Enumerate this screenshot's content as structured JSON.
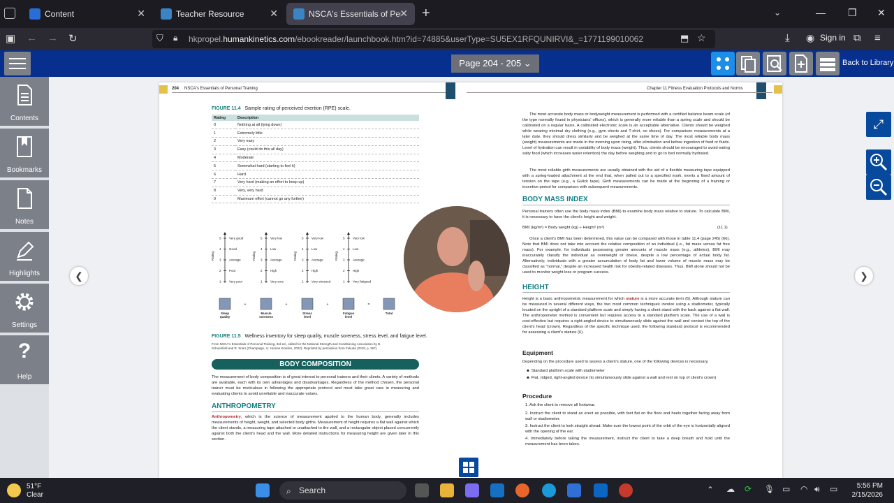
{
  "browser": {
    "tabs": [
      {
        "title": "Content",
        "favicon_color": "#2a6dd6"
      },
      {
        "title": "Teacher Resource",
        "favicon_color": "#3b84c4"
      },
      {
        "title": "NSCA's Essentials of Personal Tr",
        "favicon_color": "#3b84c4"
      }
    ],
    "url_prefix": "hkpropel.",
    "url_domain": "humankinetics.com",
    "url_path": "/ebookreader/launchbook.htm?id=74885&userType=SU5EX1RFQUNIRVI&_=1771199010062",
    "sign_in": "Sign in"
  },
  "reader": {
    "page_selector": "Page 204 - 205",
    "back_to_library": "Back to Library",
    "sidebar": [
      {
        "label": "Contents",
        "icon": "document-icon"
      },
      {
        "label": "Bookmarks",
        "icon": "bookmark-icon"
      },
      {
        "label": "Notes",
        "icon": "note-icon"
      },
      {
        "label": "Highlights",
        "icon": "pencil-icon"
      },
      {
        "label": "Settings",
        "icon": "gear-icon"
      },
      {
        "label": "Help",
        "icon": "question-icon"
      }
    ]
  },
  "book": {
    "left_page_number": "204",
    "left_running_head": "NSCA's Essentials of Personal Training",
    "right_running_head": "Chapter 11   Fitness Evaluation Protocols and Norms",
    "fig114_label": "FIGURE 11.4",
    "fig114_title": "Sample rating of perceived exertion (RPE) scale.",
    "rpe_headers": [
      "Rating",
      "Description"
    ],
    "rpe_rows": [
      [
        "0",
        "Nothing at all (lying down)"
      ],
      [
        "1",
        "Extremely little"
      ],
      [
        "2",
        "Very easy"
      ],
      [
        "3",
        "Easy (could do this all day)"
      ],
      [
        "4",
        "Moderate"
      ],
      [
        "5",
        "Somewhat hard (starting to feel it)"
      ],
      [
        "6",
        "Hard"
      ],
      [
        "7",
        "Very hard (making an effort to keep up)"
      ],
      [
        "8",
        "Very, very hard"
      ],
      [
        "9",
        "Maximum effort (cannot go any further)"
      ]
    ],
    "wellness_chart": {
      "axis_label": "Rating",
      "levels": [
        "5",
        "4",
        "3",
        "2",
        "1"
      ],
      "scales": [
        {
          "labels": [
            "Very good",
            "Good",
            "Average",
            "Poor",
            "Very poor"
          ],
          "caption": [
            "Sleep",
            "quality"
          ]
        },
        {
          "labels": [
            "Very low",
            "Low",
            "Average",
            "High",
            "Very sore"
          ],
          "caption": [
            "Muscle",
            "soreness"
          ]
        },
        {
          "labels": [
            "Very low",
            "Low",
            "Average",
            "High",
            "Very stressed"
          ],
          "caption": [
            "Stress",
            "level"
          ]
        },
        {
          "labels": [
            "Very low",
            "Low",
            "Average",
            "High",
            "Very fatigued"
          ],
          "caption": [
            "Fatigue",
            "level"
          ]
        }
      ],
      "operators": [
        "+",
        "+",
        "+",
        "="
      ],
      "total_label": "Total"
    },
    "fig115_label": "FIGURE 11.5",
    "fig115_title": "Wellness inventory for sleep quality, muscle soreness, stress level, and fatigue level.",
    "fig115_credit_1": "From NSCA's Essentials of Personal Training, 3rd ed., edited for the National Strength and Conditioning Association by B.",
    "fig115_credit_2": "Schoenfeld and R. Snarr (Champaign, IL: Human Kinetics, 2022). Reprinted by permission from Fukuda (2019, p. 267).",
    "body_comp_heading": "BODY COMPOSITION",
    "body_comp_text": "The measurement of body composition is of great interest to personal trainers and their clients. A variety of methods are available, each with its own advantages and disadvantages. Regardless of the method chosen, the personal trainer must be meticulous in following the appropriate protocol and must take great care in measuring and evaluating clients to avoid unreliable and inaccurate values.",
    "anthro_heading": "ANTHROPOMETRY",
    "anthro_term": "Anthropometry",
    "anthro_text": ", which is the science of measurement applied to the human body, generally includes measurements of height, weight, and selected body girths. Measurement of height requires a flat wall against which the client stands, a measuring tape attached or unattached to the wall, and a rectangular object placed concurrently against both the client's head and the wall. More detailed instructions for measuring height are given later in this section.",
    "right_p1": "The most accurate body mass or bodyweight measurement is performed with a certified balance beam scale (of the type normally found in physicians' offices), which is generally more reliable than a spring scale and should be calibrated on a regular basis. A calibrated electronic scale is an acceptable alternative. Clients should be weighed while wearing minimal dry clothing (e.g., gym shorts and T-shirt, no shoes). For comparison measurements at a later date, they should dress similarly and be weighed at the same time of day. The most reliable body mass (weight) measurements are made in the morning upon rising, after elimination and before ingestion of food or fluids. Level of hydration can result in variability of body mass (weight). Thus, clients should be encouraged to avoid eating salty food (which increases water retention) the day before weighing and to go to bed normally hydrated.",
    "right_p2": "The most reliable girth measurements are usually obtained with the aid of a flexible measuring tape equipped with a spring-loaded attachment at the end that, when pulled out to a specified mark, exerts a fixed amount of tension on the tape (e.g., a Gulick tape). Girth measurements can be made at the beginning of a training or incentive period for comparison with subsequent measurements.",
    "bmi_heading": "BODY MASS INDEX",
    "bmi_p1": "Personal trainers often use the body mass index (BMI) to examine body mass relative to stature. To calculate BMI, it is necessary to have the client's height and weight.",
    "bmi_formula": "BMI (kg/m²) = Body weight (kg) ÷ Height² (m²)",
    "bmi_eq_num": "(11.1)",
    "bmi_p2": "Once a client's BMI has been determined, this value can be compared with those in table 11.4 (page 245) (66). Note that BMI does not take into account the relative composition of an individual (i.e., fat mass versus fat free mass). For example, for individuals possessing greater amounts of muscle mass (e.g., athletes), BMI may inaccurately classify the individual as overweight or obese, despite a low percentage of actual body fat. Alternatively, individuals with a greater accumulation of body fat and lower volume of muscle mass may be classified as \"normal,\" despite an increased health risk for obesity-related diseases. Thus, BMI alone should not be used to monitor weight loss or program success.",
    "height_heading": "HEIGHT",
    "height_p_a": "Height is a basic anthropometric measurement for which ",
    "height_term": "stature",
    "height_p_b": " is a more accurate term (6). Although stature can be measured in several different ways, the two most common techniques involve using a stadiometer, typically located on the upright of a standard platform scale and simply having a client stand with the back against a flat wall. The anthropometer method is convenient but requires access to a standard platform scale. The use of a wall is cost-effective but requires a right-angled device to simultaneously slide against the wall and contact the top of the client's head (crown). Regardless of the specific technique used, the following standard protocol is recommended for assessing a client's stature (6).",
    "equipment_heading": "Equipment",
    "equipment_intro": "Depending on the procedure used to assess a client's stature, one of the following devices is necessary.",
    "equipment_items": [
      "Standard platform scale with stadiometer",
      "Flat, ridged, right-angled device (to simultaneously slide against a wall and rest on top of client's crown)"
    ],
    "procedure_heading": "Procedure",
    "procedure_steps": [
      "1.  Ask the client to remove all footwear.",
      "2.  Instruct the client to stand as erect as possible, with feet flat on the floor and heels together facing away from wall or stadiometer.",
      "3.  Instruct the client to look straight ahead. Make sure the lowest point of the orbit of the eye is horizontally aligned with the opening of the ear.",
      "4.  Immediately before taking the measurement, instruct the client to take a deep breath and hold until the measurement has been taken."
    ]
  },
  "taskbar": {
    "temperature": "51°F",
    "condition": "Clear",
    "search_placeholder": "Search",
    "time": "5:56 PM",
    "date": "2/15/2026"
  },
  "colors": {
    "reader_header": "#072f8d",
    "accent_teal": "#137f83",
    "banner": "#16605e",
    "tool_blue": "#074a9d"
  }
}
